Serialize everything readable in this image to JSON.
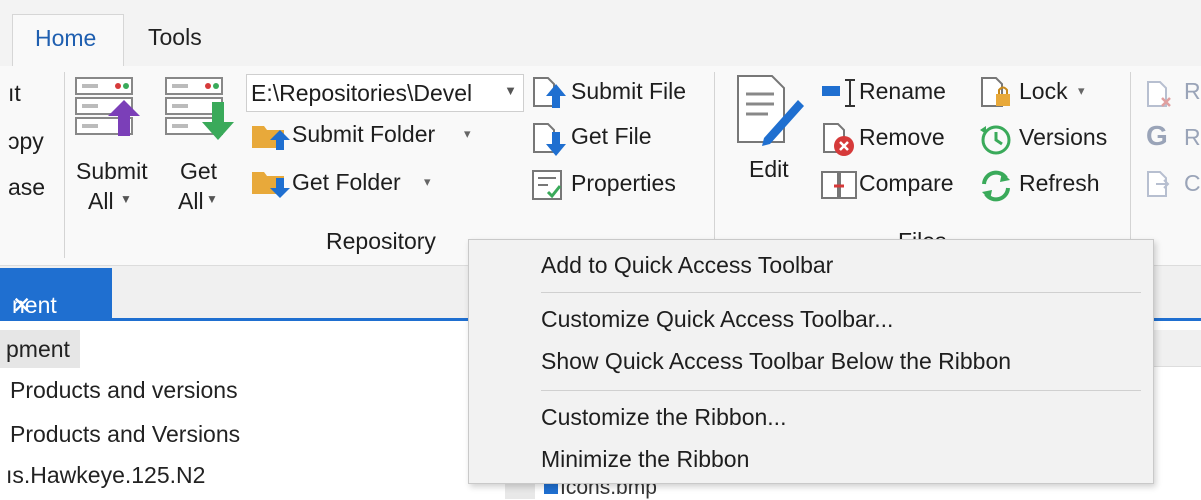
{
  "tabs": {
    "home": "Home",
    "tools": "Tools"
  },
  "ribbon": {
    "left_cut": [
      "ıt",
      "ɔpy",
      "ase"
    ],
    "submit_all": [
      "Submit",
      "All"
    ],
    "get_all": [
      "Get",
      "All"
    ],
    "path": "E:\\Repositories\\Devel",
    "submit_folder": "Submit Folder",
    "get_folder": "Get Folder",
    "submit_file": "Submit File",
    "get_file": "Get File",
    "properties": "Properties",
    "group_repository": "Repository",
    "edit": "Edit",
    "rename": "Rename",
    "remove": "Remove",
    "compare": "Compare",
    "lock": "Lock",
    "versions": "Versions",
    "refresh": "Refresh",
    "group_files": "Files",
    "right_cut": [
      "R",
      "R",
      "C"
    ]
  },
  "doc_tab": {
    "label": "nent",
    "close": "✕"
  },
  "tree": [
    "pment",
    "Products and versions",
    "Products and Versions",
    "ıs.Hawkeye.125.N2"
  ],
  "file_item": "Icons.bmp",
  "context_menu": {
    "items": [
      "Add to Quick Access Toolbar",
      "Customize Quick Access Toolbar...",
      "Show Quick Access Toolbar Below the Ribbon",
      "Customize the Ribbon...",
      "Minimize the Ribbon"
    ]
  },
  "colors": {
    "accent": "#1f6fd0",
    "tab_text": "#1f5fb0",
    "purple": "#7b3fb8",
    "green": "#3aaa5a",
    "red": "#d63a3a"
  }
}
